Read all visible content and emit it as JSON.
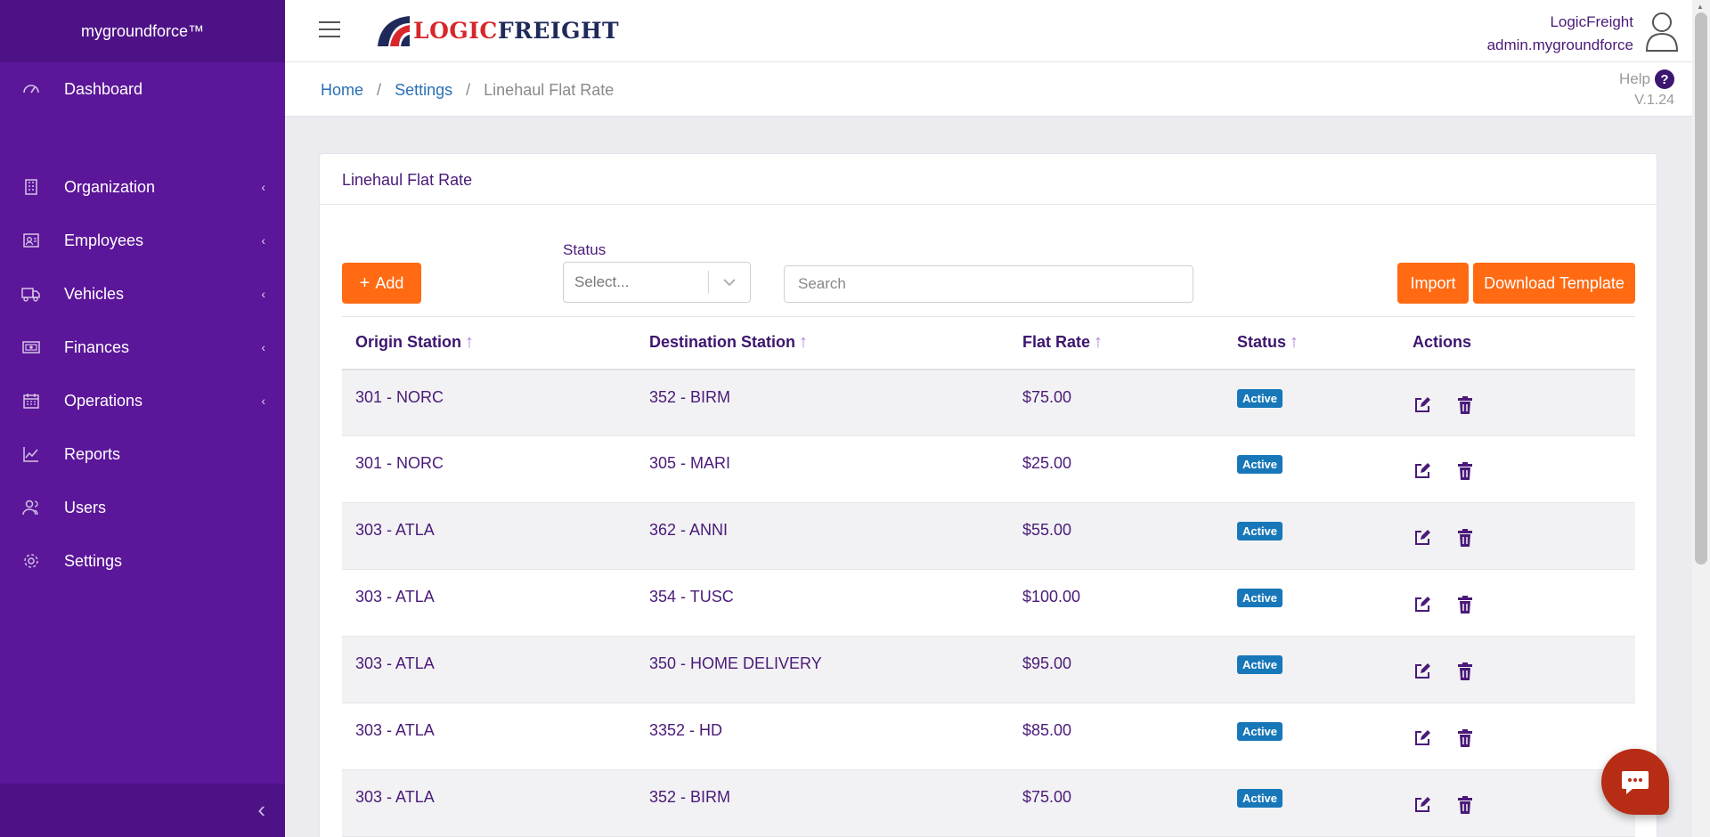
{
  "sidebar": {
    "brand": "mygroundforce™",
    "items": [
      {
        "label": "Dashboard",
        "icon": "dashboard-icon"
      },
      {
        "label": "Organization",
        "icon": "building-icon",
        "has_children": true
      },
      {
        "label": "Employees",
        "icon": "id-badge-icon",
        "has_children": true
      },
      {
        "label": "Vehicles",
        "icon": "truck-icon",
        "has_children": true
      },
      {
        "label": "Finances",
        "icon": "money-icon",
        "has_children": true
      },
      {
        "label": "Operations",
        "icon": "calendar-icon",
        "has_children": true
      },
      {
        "label": "Reports",
        "icon": "chart-line-icon"
      },
      {
        "label": "Users",
        "icon": "users-icon"
      },
      {
        "label": "Settings",
        "icon": "gear-icon"
      }
    ],
    "collapse_glyph": "‹"
  },
  "header": {
    "logo": {
      "part1": "LOGIC",
      "part2": "FREIGHT"
    },
    "user": {
      "company": "LogicFreight",
      "account": "admin.mygroundforce"
    }
  },
  "breadcrumb": {
    "home": "Home",
    "settings": "Settings",
    "current": "Linehaul Flat Rate",
    "separator": "/"
  },
  "help": {
    "label": "Help",
    "icon_glyph": "?",
    "version": "V.1.24"
  },
  "card": {
    "title": "Linehaul Flat Rate",
    "add_label": "Add",
    "add_glyph": "+",
    "status_label": "Status",
    "status_placeholder": "Select...",
    "search_placeholder": "Search",
    "import_label": "Import",
    "download_label": "Download Template"
  },
  "table": {
    "columns": [
      "Origin Station",
      "Destination Station",
      "Flat Rate",
      "Status",
      "Actions"
    ],
    "sort_glyph": "↑",
    "rows": [
      {
        "origin": "301 - NORC",
        "destination": "352 - BIRM",
        "rate": "$75.00",
        "status": "Active"
      },
      {
        "origin": "301 - NORC",
        "destination": "305 - MARI",
        "rate": "$25.00",
        "status": "Active"
      },
      {
        "origin": "303 - ATLA",
        "destination": "362 - ANNI",
        "rate": "$55.00",
        "status": "Active"
      },
      {
        "origin": "303 - ATLA",
        "destination": "354 - TUSC",
        "rate": "$100.00",
        "status": "Active"
      },
      {
        "origin": "303 - ATLA",
        "destination": "350 - HOME DELIVERY",
        "rate": "$95.00",
        "status": "Active"
      },
      {
        "origin": "303 - ATLA",
        "destination": "3352 - HD",
        "rate": "$85.00",
        "status": "Active"
      },
      {
        "origin": "303 - ATLA",
        "destination": "352 - BIRM",
        "rate": "$75.00",
        "status": "Active"
      }
    ]
  },
  "colors": {
    "sidebar": "#5b1699",
    "accent": "#ff6a13",
    "badge": "#1877b9",
    "text": "#4a1a78"
  }
}
